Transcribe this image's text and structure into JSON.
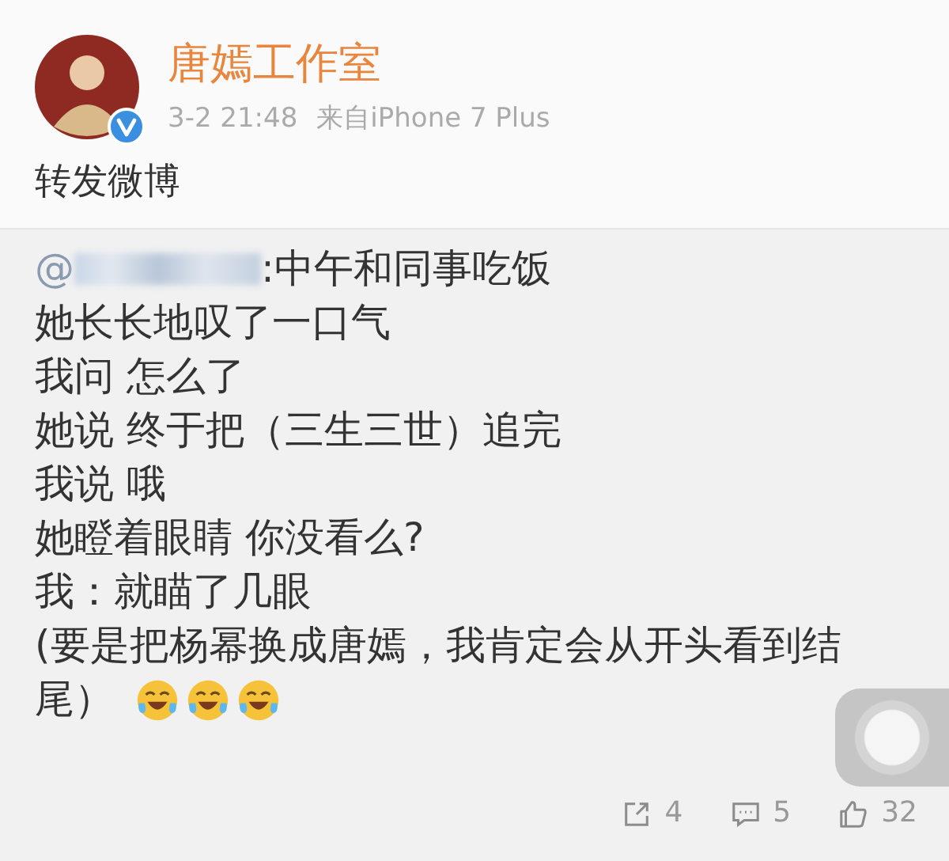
{
  "author": {
    "name": "唐嫣工作室",
    "verified": true
  },
  "meta": {
    "time": "3-2 21:48",
    "source": "来自iPhone 7 Plus"
  },
  "text": "转发微博",
  "repost": {
    "mention": "@",
    "first_line": ":中午和同事吃饭",
    "lines": [
      "她长长地叹了一口气",
      "我问 怎么了",
      "她说 终于把（三生三世）追完",
      "我说 哦",
      "她瞪着眼睛 你没看么?",
      "我：就瞄了几眼",
      "(要是把杨幂换成唐嫣，我肯定会从开头看到结"
    ],
    "last": {
      "text": "尾）",
      "emojis": [
        {
          "kind": "tears-of-joy"
        },
        {
          "kind": "tears-of-joy"
        },
        {
          "kind": "tears-of-joy"
        }
      ]
    },
    "actions": [
      {
        "kind": "repost",
        "count": "4"
      },
      {
        "kind": "comment",
        "count": "5"
      },
      {
        "kind": "like",
        "count": "32"
      }
    ]
  }
}
